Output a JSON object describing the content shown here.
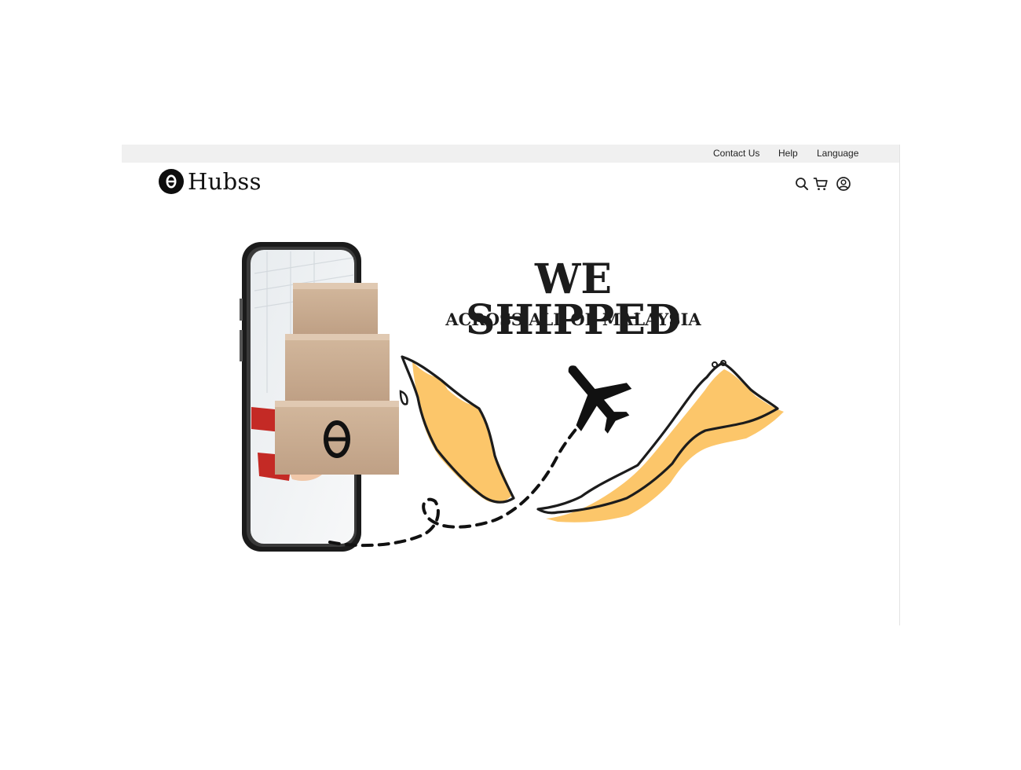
{
  "topbar": {
    "links": [
      "Contact Us",
      "Help",
      "Language"
    ]
  },
  "brand": {
    "name": "Hubss",
    "mark_glyph": "θ"
  },
  "header_icons": [
    "search-icon",
    "cart-icon",
    "account-icon"
  ],
  "hero": {
    "headline": "WE SHIPPED",
    "subheadline": "ACROSS ALL OF MALAYSIA",
    "box_glyph": "θ"
  },
  "colors": {
    "topbar_bg": "#f0f0f0",
    "map_fill": "#fcc66a",
    "ink": "#111111",
    "box": "#c9a98a"
  }
}
